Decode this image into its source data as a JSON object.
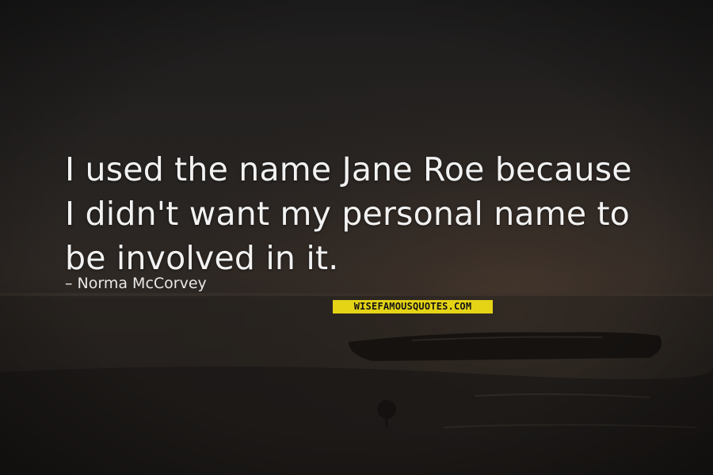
{
  "quote": {
    "lines": [
      "I used the name Jane Roe because",
      "I didn't want my personal name to",
      "be involved in it."
    ]
  },
  "author": "Norma McCorvey",
  "author_prefix": "–",
  "watermark": "WISEFAMOUSQUOTES.COM",
  "colors": {
    "background": "#1b1a1a",
    "quote_text": "#f2f2f2",
    "watermark_bg": "#e5d316"
  }
}
